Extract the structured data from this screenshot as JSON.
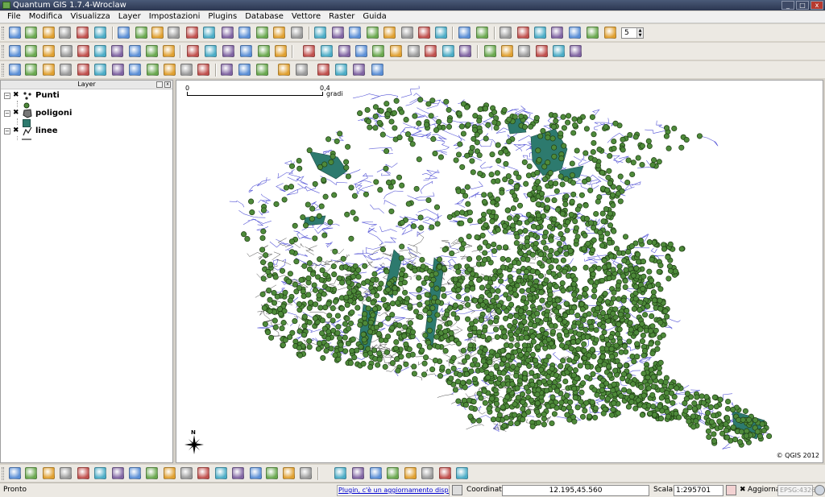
{
  "window": {
    "title": "Quantum GIS 1.7.4-Wroclaw",
    "controls": [
      "_",
      "□",
      "x"
    ]
  },
  "menu": [
    "File",
    "Modifica",
    "Visualizza",
    "Layer",
    "Impostazioni",
    "Plugins",
    "Database",
    "Vettore",
    "Raster",
    "Guida"
  ],
  "toolbar": {
    "spin_value": "5"
  },
  "layers_panel": {
    "title": "Layer",
    "layers": [
      {
        "name": "Punti",
        "checked": "✖",
        "expander": "−",
        "symbol_color": "#4e8a3a"
      },
      {
        "name": "poligoni",
        "checked": "✖",
        "expander": "−",
        "symbol_color": "#2d7a6e"
      },
      {
        "name": "linee",
        "checked": "✖",
        "expander": "−",
        "symbol_color": "#000000"
      }
    ]
  },
  "map": {
    "scalebar": {
      "min": "0",
      "max": "0,4",
      "unit": "gradi"
    },
    "north": "N",
    "copyright": "© QGIS 2012",
    "colors": {
      "points": "#4e8a3a",
      "points_stroke": "#1e3e14",
      "polygons": "#2d7a6e",
      "lines": "#3a3ad0",
      "roads": "#000000"
    }
  },
  "status": {
    "ready": "Pronto",
    "plugin_message": "Plugin, c'è un aggiornamento disponibile",
    "coord_label": "Coordinata:",
    "coord_value": "12.195,45.560",
    "scale_label": "Scala",
    "scale_value": "1:295701",
    "refresh_label": "Aggiorna",
    "refresh_checked": "✖",
    "crs": "EPSG:4326"
  }
}
